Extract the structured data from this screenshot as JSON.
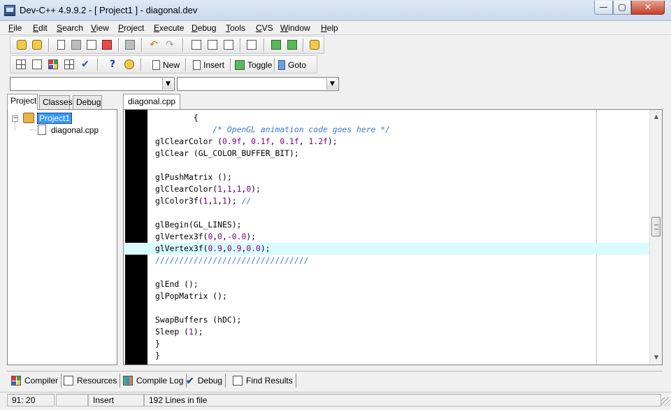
{
  "window": {
    "title": "Dev-C++ 4.9.9.2  - [ Project1 ] - diagonal.dev",
    "minimize": "—",
    "maximize": "▢",
    "close": "✕"
  },
  "menu": [
    "File",
    "Edit",
    "Search",
    "View",
    "Project",
    "Execute",
    "Debug",
    "Tools",
    "CVS",
    "Window",
    "Help"
  ],
  "toolbar2": {
    "new_label": "New",
    "insert_label": "Insert",
    "toggle_label": "Toggle",
    "goto_label": "Goto"
  },
  "combos": {
    "left_value": "",
    "right_value": ""
  },
  "left_tabs": [
    "Project",
    "Classes",
    "Debug"
  ],
  "tree": {
    "project": "Project1",
    "file": "diagonal.cpp",
    "expander": "−"
  },
  "editor": {
    "tab": "diagonal.cpp",
    "lines": [
      "        {",
      "            /* OpenGL animation code goes here */",
      "glClearColor (0.9f, 0.1f, 0.1f, 1.2f);",
      "glClear (GL_COLOR_BUFFER_BIT);",
      "",
      "glPushMatrix ();",
      "glClearColor(1,1,1,0);",
      "glColor3f(1,1,1); //",
      "",
      "glBegin(GL_LINES);",
      "glVertex3f(0,0,-0.0);",
      "glVertex3f(0.9,0.9,0.0);",
      "////////////////////////////////",
      "",
      "glEnd ();",
      "glPopMatrix ();",
      "",
      "SwapBuffers (hDC);",
      "Sleep (1);",
      "}",
      "}"
    ],
    "highlighted_line_index": 11,
    "scroll_position": 0.45
  },
  "bottom_tabs": [
    "Compiler",
    "Resources",
    "Compile Log",
    "Debug",
    "Find Results"
  ],
  "status": {
    "position": "91: 20",
    "empty": "",
    "mode": "Insert",
    "lines": "192 Lines in file"
  }
}
